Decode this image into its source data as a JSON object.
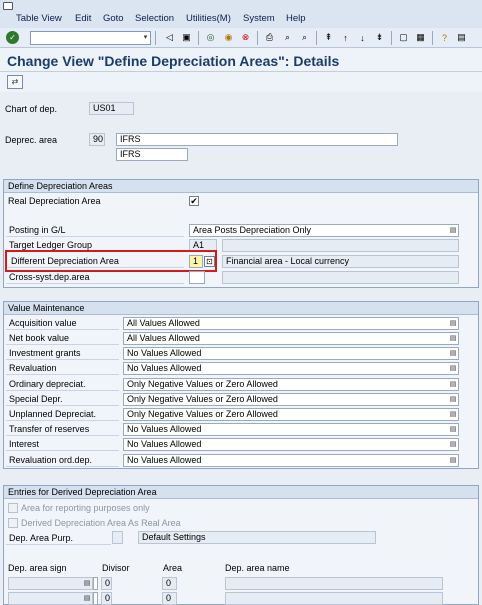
{
  "menubar": {
    "items": [
      "Table View",
      "Edit",
      "Goto",
      "Selection",
      "Utilities(M)",
      "System",
      "Help"
    ]
  },
  "page_title": "Change View \"Define Depreciation Areas\": Details",
  "header_fields": {
    "chart_label": "Chart of dep.",
    "chart_value": "US01",
    "deprec_label": "Deprec. area",
    "deprec_value": "90",
    "deprec_name": "IFRS",
    "deprec_short": "IFRS"
  },
  "define_areas": {
    "title": "Define Depreciation Areas",
    "real_label": "Real Depreciation Area",
    "real_checked": "✔",
    "posting_label": "Posting in G/L",
    "posting_value": "Area Posts Depreciation Only",
    "target_label": "Target Ledger Group",
    "target_value": "A1",
    "diff_label": "Different Depreciation Area",
    "diff_value": "1",
    "diff_desc": "Financial area - Local currency",
    "cross_label": "Cross-syst.dep.area"
  },
  "value_maintenance": {
    "title": "Value Maintenance",
    "rows": [
      {
        "label": "Acquisition value",
        "value": "All Values Allowed"
      },
      {
        "label": "Net book value",
        "value": "All Values Allowed"
      },
      {
        "label": "Investment grants",
        "value": "No Values Allowed"
      },
      {
        "label": "Revaluation",
        "value": "No Values Allowed"
      },
      {
        "label": "Ordinary depreciat.",
        "value": "Only Negative Values or Zero Allowed"
      },
      {
        "label": "Special Depr.",
        "value": "Only Negative Values or Zero Allowed"
      },
      {
        "label": "Unplanned Depreciat.",
        "value": "Only Negative Values or Zero Allowed"
      },
      {
        "label": "Transfer of reserves",
        "value": "No Values Allowed"
      },
      {
        "label": "Interest",
        "value": "No Values Allowed"
      },
      {
        "label": "Revaluation ord.dep.",
        "value": "No Values Allowed"
      }
    ]
  },
  "derived": {
    "title": "Entries for Derived Depreciation Area",
    "opt1": "Area for reporting purposes only",
    "opt2": "Derived Depreciation Area As Real Area",
    "purp_label": "Dep. Area Purp.",
    "purp_value": "Default Settings",
    "col_sign": "Dep. area sign",
    "col_divisor": "Divisor",
    "col_area": "Area",
    "col_name": "Dep. area name",
    "row1_divisor": "0",
    "row1_area": "0",
    "row2_divisor": "0",
    "row2_area": "0"
  },
  "colors": {
    "title": "#1a3d6b",
    "highlight_border": "#d61a1a",
    "group_header": "#d5e1ef"
  }
}
